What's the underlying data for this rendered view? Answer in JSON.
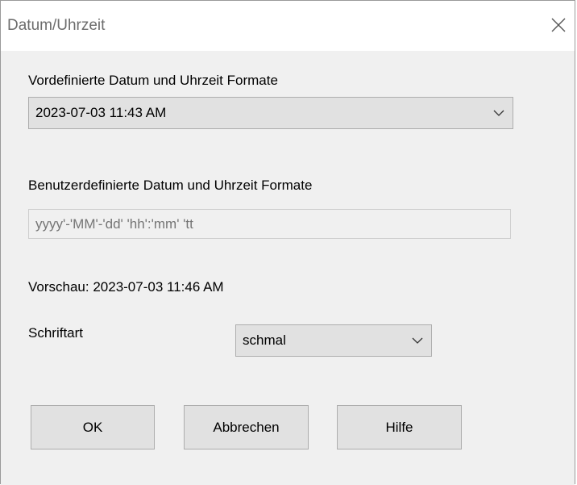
{
  "window": {
    "title": "Datum/Uhrzeit",
    "close_icon": "close-icon"
  },
  "predefined": {
    "label": "Vordefinierte Datum und Uhrzeit Formate",
    "selected": "2023-07-03 11:43 AM"
  },
  "custom": {
    "label": "Benutzerdefinierte Datum und Uhrzeit Formate",
    "placeholder": "yyyy'-'MM'-'dd' 'hh':'mm' 'tt"
  },
  "preview": {
    "text": "Vorschau: 2023-07-03 11:46 AM"
  },
  "font": {
    "label": "Schriftart",
    "selected": "schmal"
  },
  "buttons": {
    "ok": "OK",
    "cancel": "Abbrechen",
    "help": "Hilfe"
  },
  "colors": {
    "dialog_bg": "#f0f0f0",
    "titlebar_bg": "#ffffff",
    "button_bg": "#e1e1e1",
    "border": "#adadad"
  }
}
